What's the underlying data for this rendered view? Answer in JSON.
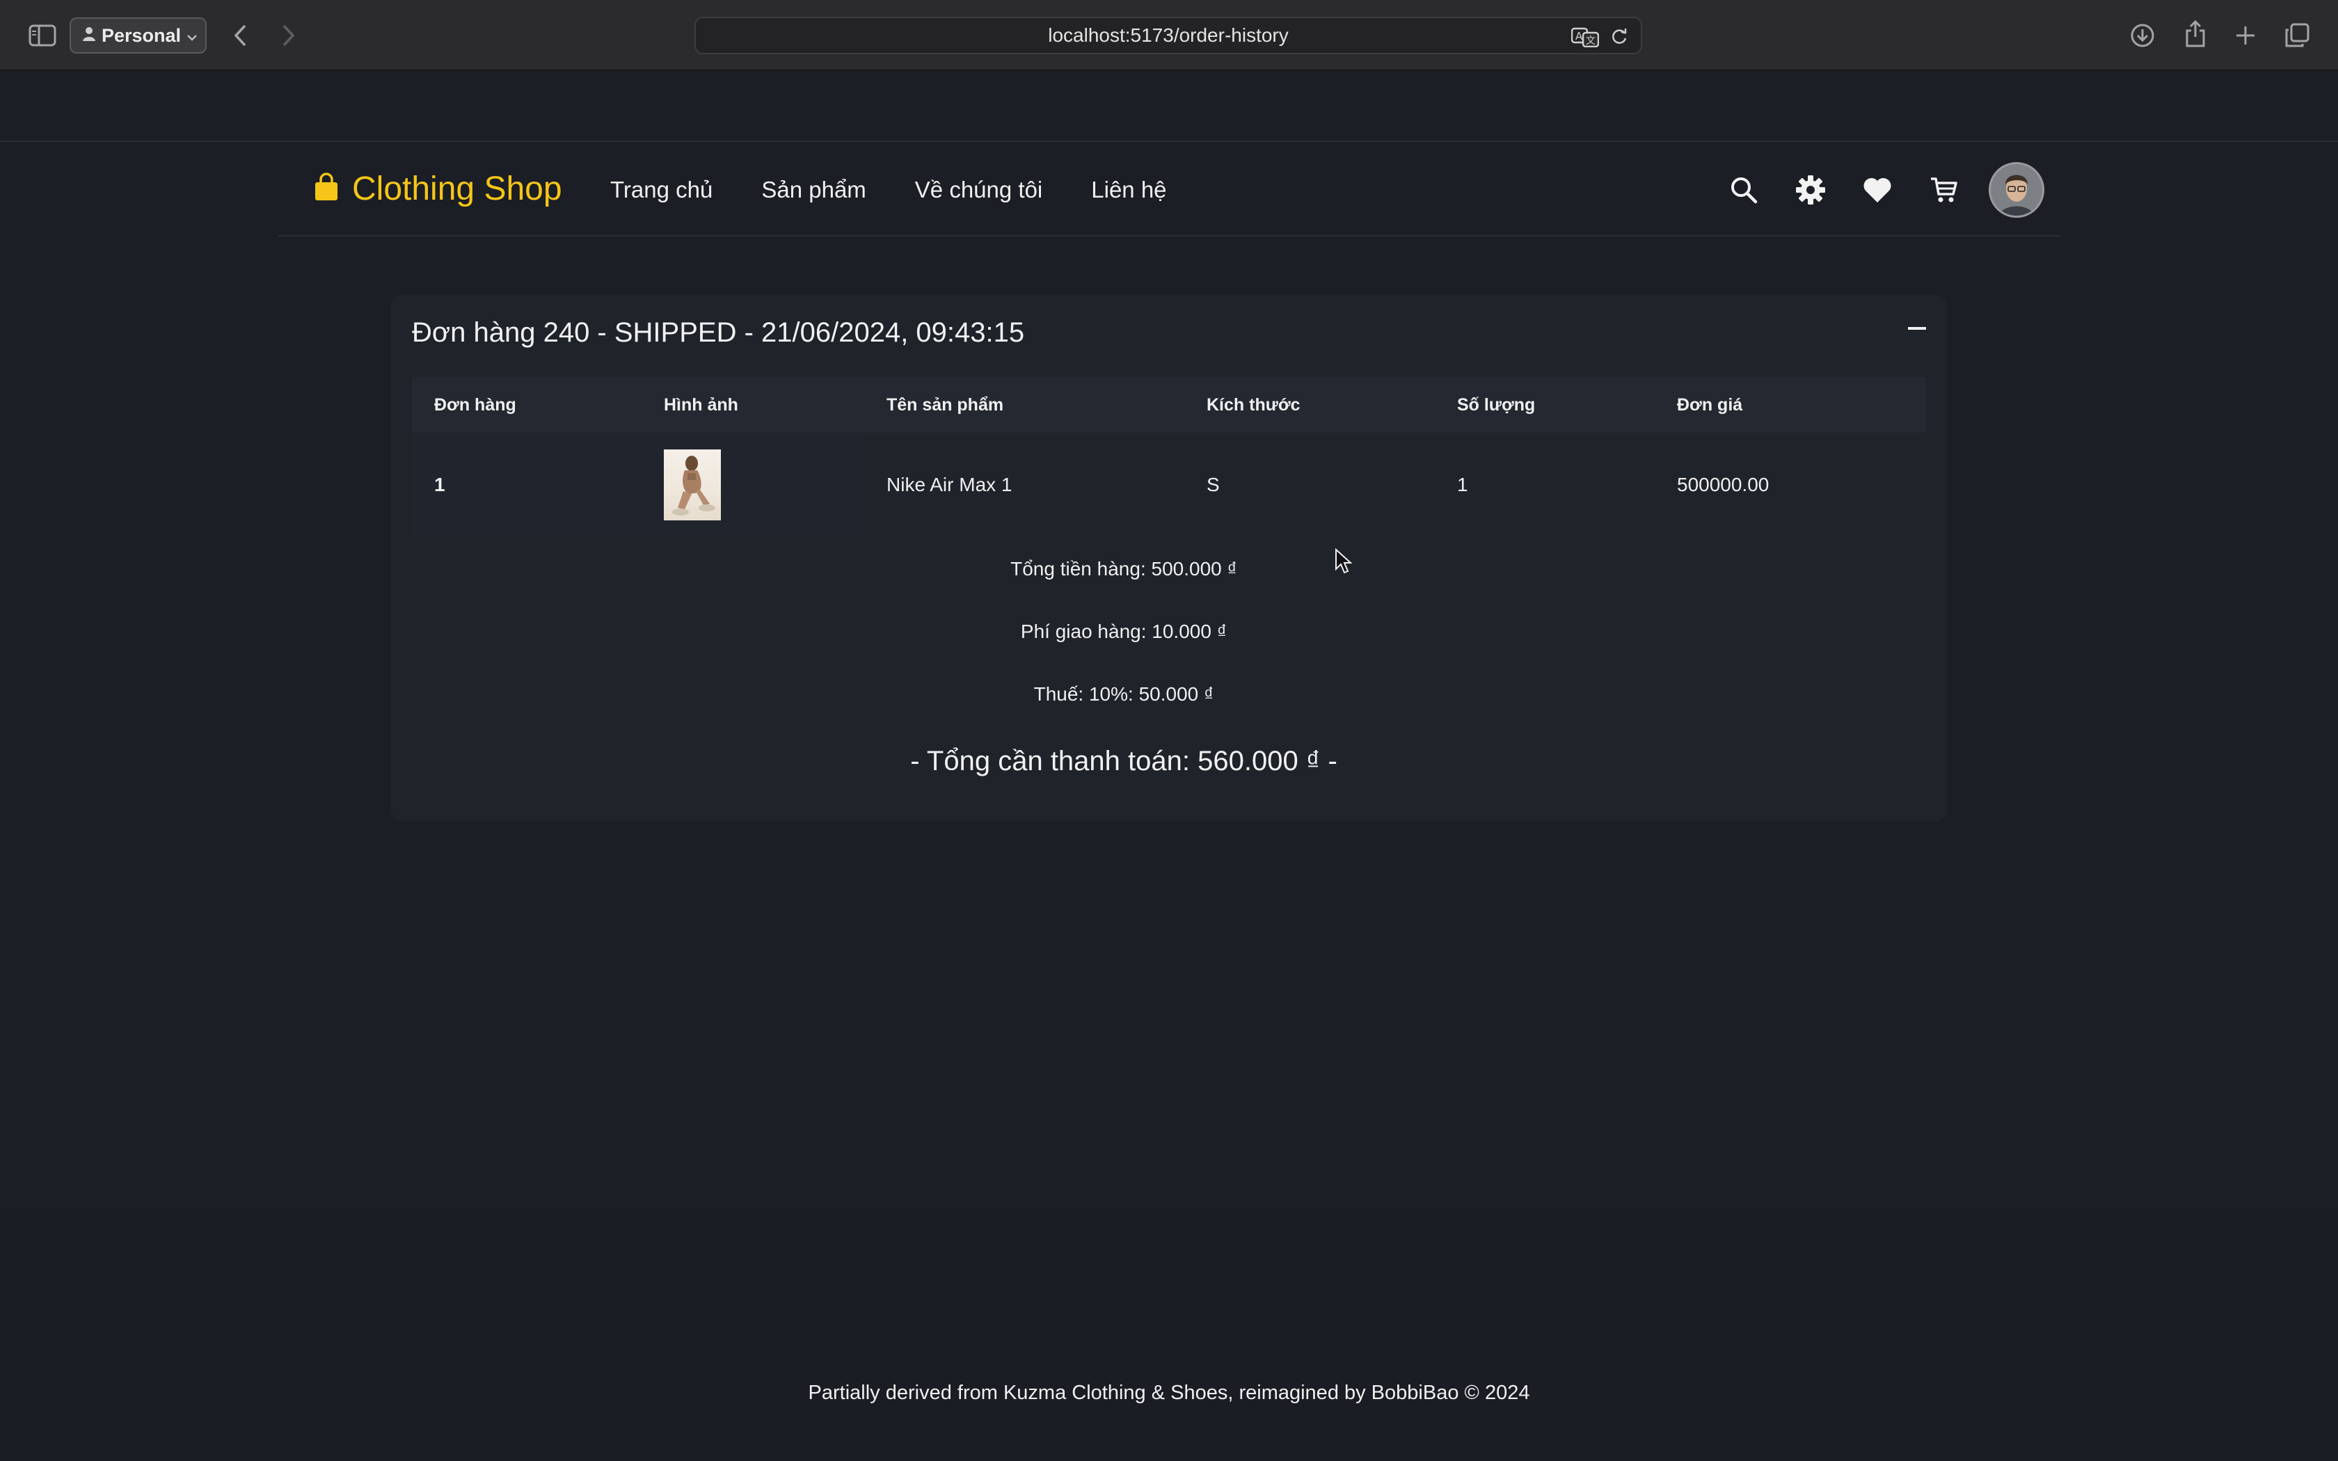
{
  "browser": {
    "profile_label": "Personal",
    "url": "localhost:5173/order-history"
  },
  "navbar": {
    "brand": "Clothing Shop",
    "links": [
      "Trang chủ",
      "Sản phẩm",
      "Về chúng tôi",
      "Liên hệ"
    ]
  },
  "order": {
    "title": "Đơn hàng 240 - SHIPPED - 21/06/2024, 09:43:15",
    "columns": [
      "Đơn hàng",
      "Hình ảnh",
      "Tên sản phẩm",
      "Kích thước",
      "Số lượng",
      "Đơn giá"
    ],
    "rows": [
      {
        "index": "1",
        "name": "Nike Air Max 1",
        "size": "S",
        "quantity": "1",
        "price": "500000.00"
      }
    ],
    "subtotal": "Tổng tiền hàng: 500.000 ₫",
    "shipping": "Phí giao hàng: 10.000 ₫",
    "tax": "Thuế: 10%: 50.000 ₫",
    "grand_total": "- Tổng cần thanh toán: 560.000 ₫ -"
  },
  "footer": {
    "text": "Partially derived from Kuzma Clothing & Shoes, reimagined by BobbiBao © 2024"
  },
  "colors": {
    "accent": "#f5c518",
    "page_bg": "#1b1e24",
    "card_bg": "#1f232a"
  }
}
